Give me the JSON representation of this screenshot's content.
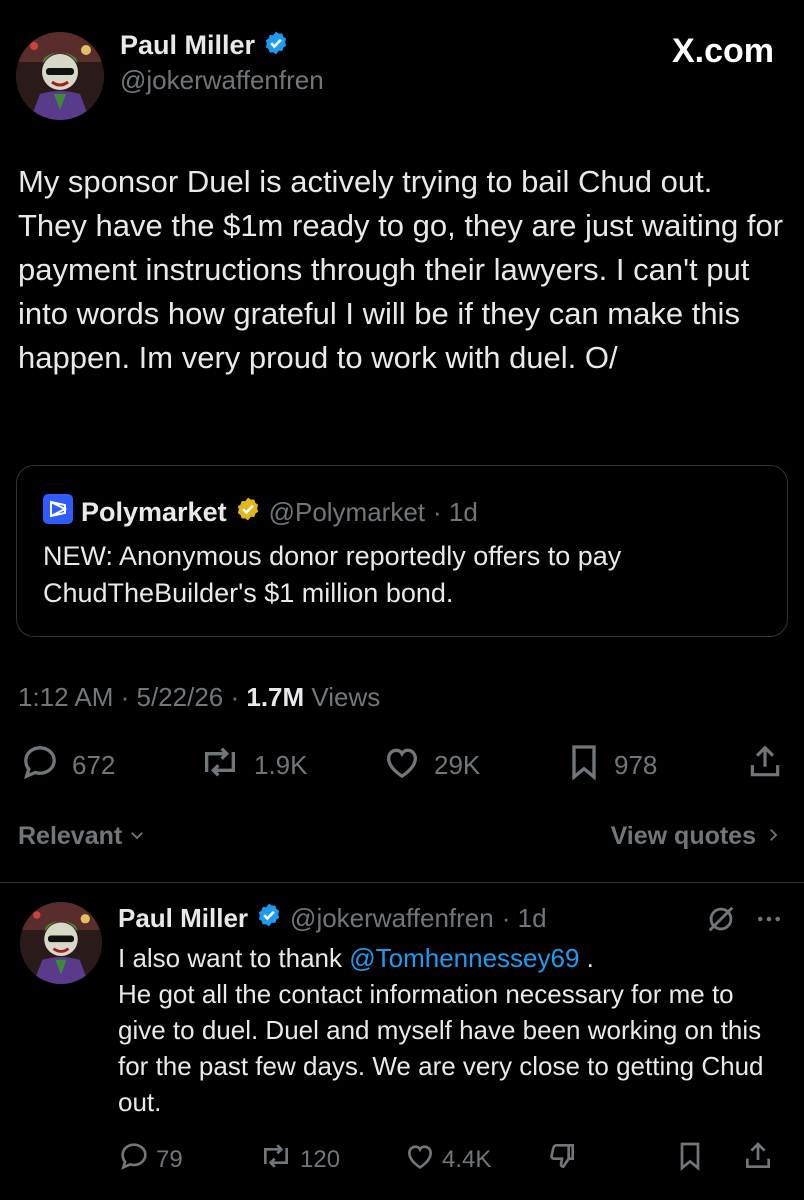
{
  "main_tweet": {
    "author_name": "Paul Miller",
    "author_handle": "@jokerwaffenfren",
    "brand": "X.com",
    "text": "My sponsor Duel is actively trying to bail Chud out. They have the $1m ready to go, they are just waiting for payment instructions through their lawyers. I can't put into words how grateful I will be if they can make this happen. Im very proud to work with duel. O/",
    "quote": {
      "name": "Polymarket",
      "handle": "@Polymarket",
      "time": "· 1d",
      "text": "NEW: Anonymous donor reportedly offers to pay ChudTheBuilder's $1 million bond."
    },
    "timestamp": "1:12 AM · 5/22/26 · ",
    "views_count": "1.7M",
    "views_label": " Views",
    "actions": {
      "replies": "672",
      "reposts": "1.9K",
      "likes": "29K",
      "bookmarks": "978"
    }
  },
  "filter": {
    "sort_label": "Relevant",
    "view_quotes_label": "View quotes"
  },
  "reply": {
    "author_name": "Paul Miller",
    "author_handle": "@jokerwaffenfren",
    "time": "· 1d",
    "text_before_mention": "I also want to thank ",
    "mention": "@Tomhennessey69",
    "text_after_mention": " .",
    "text_rest": "He got all the contact information necessary for me to give to duel. Duel and myself have been working on this for the past few days. We are very close to getting Chud out.",
    "actions": {
      "replies": "79",
      "reposts": "120",
      "likes": "4.4K"
    }
  },
  "colors": {
    "background": "#000000",
    "text": "#e7e9ea",
    "muted": "#71767b",
    "link": "#1d9bf0",
    "verified_blue": "#1d9bf0",
    "verified_gold": "#e2b719"
  },
  "icons": [
    "verified-badge-icon",
    "polymarket-logo-icon",
    "reply-icon",
    "repost-icon",
    "like-icon",
    "bookmark-icon",
    "share-icon",
    "chevron-down-icon",
    "chevron-right-icon",
    "grok-icon",
    "more-icon",
    "dislike-icon"
  ]
}
